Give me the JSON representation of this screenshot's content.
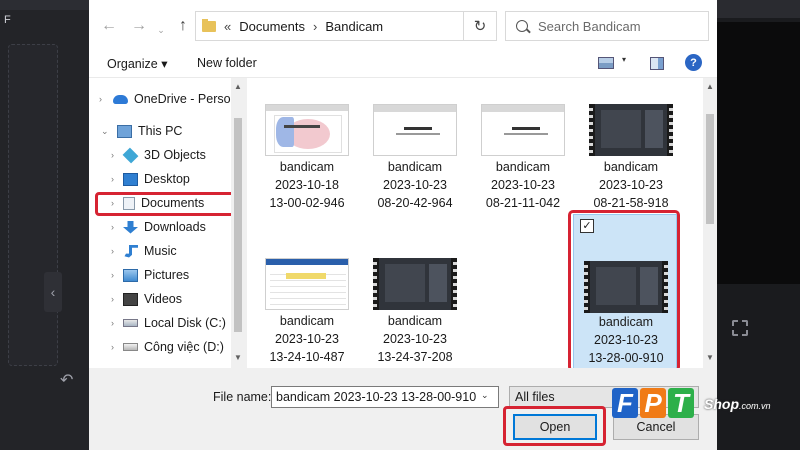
{
  "background_app": {
    "left_letter": "F",
    "collapse_glyph": "‹",
    "undo_glyph": "↶"
  },
  "address_bar": {
    "back_glyph": "←",
    "forward_glyph": "→",
    "recent_glyph": "⌄",
    "up_glyph": "↑",
    "breadcrumb_start": "«",
    "breadcrumbs": [
      "Documents",
      "Bandicam"
    ],
    "breadcrumb_separator": "›",
    "dropdown_glyph": "⌄",
    "refresh_glyph": "↻",
    "search_placeholder": "Search Bandicam"
  },
  "toolbar": {
    "organize_label": "Organize ▾",
    "new_folder_label": "New folder",
    "view_dropdown_glyph": "▾",
    "help_glyph": "?"
  },
  "nav_pane": {
    "items": [
      {
        "label": "OneDrive - Person",
        "icon": "onedrive-icon"
      },
      {
        "label": "This PC",
        "icon": "computer-icon"
      },
      {
        "label": "3D Objects",
        "icon": "3d-objects-icon"
      },
      {
        "label": "Desktop",
        "icon": "desktop-icon"
      },
      {
        "label": "Documents",
        "icon": "documents-icon"
      },
      {
        "label": "Downloads",
        "icon": "downloads-icon"
      },
      {
        "label": "Music",
        "icon": "music-icon"
      },
      {
        "label": "Pictures",
        "icon": "pictures-icon"
      },
      {
        "label": "Videos",
        "icon": "videos-icon"
      },
      {
        "label": "Local Disk (C:)",
        "icon": "disk-icon"
      },
      {
        "label": "Công việc (D:)",
        "icon": "disk-icon"
      }
    ],
    "selected": "Documents",
    "chevron_glyph": "›",
    "expanded_chevron_glyph": "⌄"
  },
  "files": [
    {
      "name": "bandicam",
      "date": "2023-10-18",
      "time": "13-00-02-946",
      "thumb": "presentation"
    },
    {
      "name": "bandicam",
      "date": "2023-10-23",
      "time": "08-20-42-964",
      "thumb": "document"
    },
    {
      "name": "bandicam",
      "date": "2023-10-23",
      "time": "08-21-11-042",
      "thumb": "document"
    },
    {
      "name": "bandicam",
      "date": "2023-10-23",
      "time": "08-21-58-918",
      "thumb": "video"
    },
    {
      "name": "bandicam",
      "date": "2023-10-23",
      "time": "13-24-10-487",
      "thumb": "spreadsheet"
    },
    {
      "name": "bandicam",
      "date": "2023-10-23",
      "time": "13-24-37-208",
      "thumb": "video"
    },
    {
      "name": "bandicam",
      "date": "2023-10-23",
      "time": "13-28-00-910",
      "thumb": "video",
      "selected": true
    }
  ],
  "file_checkbox_glyph": "✓",
  "scroll_glyphs": {
    "up": "▲",
    "down": "▼"
  },
  "bottom": {
    "file_name_label": "File name:",
    "file_name_value": "bandicam 2023-10-23 13-28-00-910",
    "file_name_dropdown_glyph": "⌄",
    "file_type_value": "All files",
    "open_label": "Open",
    "cancel_label": "Cancel"
  },
  "watermark": {
    "letters": [
      "F",
      "P",
      "T"
    ],
    "shop": "Shop",
    "domain": ".com.vn"
  },
  "colors": {
    "highlight_red": "#d62332",
    "selection_blue": "#cce4f7",
    "accent_blue": "#0078d7"
  }
}
